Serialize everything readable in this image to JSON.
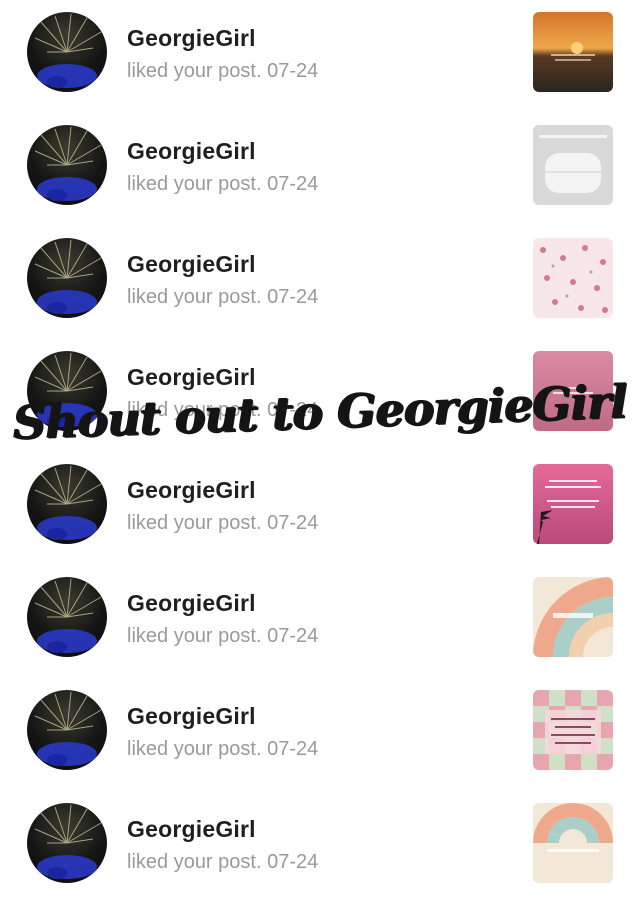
{
  "notifications": [
    {
      "username": "GeorgieGirl",
      "action": "liked your post. 07-24",
      "thumbnail": "sunset-sea-thumbnail"
    },
    {
      "username": "GeorgieGirl",
      "action": "liked your post. 07-24",
      "thumbnail": "white-bag-thumbnail"
    },
    {
      "username": "GeorgieGirl",
      "action": "liked your post. 07-24",
      "thumbnail": "floral-pattern-thumbnail"
    },
    {
      "username": "GeorgieGirl",
      "action": "liked your post. 07-24",
      "thumbnail": "pink-sky-thumbnail"
    },
    {
      "username": "GeorgieGirl",
      "action": "liked your post. 07-24",
      "thumbnail": "palm-sunset-thumbnail"
    },
    {
      "username": "GeorgieGirl",
      "action": "liked your post. 07-24",
      "thumbnail": "pastel-rainbow-thumbnail"
    },
    {
      "username": "GeorgieGirl",
      "action": "liked your post. 07-24",
      "thumbnail": "checkered-card-thumbnail"
    },
    {
      "username": "GeorgieGirl",
      "action": "liked your post. 07-24",
      "thumbnail": "pastel-arc-thumbnail"
    }
  ],
  "overlay": {
    "text": "Shout out to GeorgieGirl"
  },
  "colors": {
    "username": "#1f1f1f",
    "subtext": "#9a9a9a",
    "background": "#ffffff"
  }
}
